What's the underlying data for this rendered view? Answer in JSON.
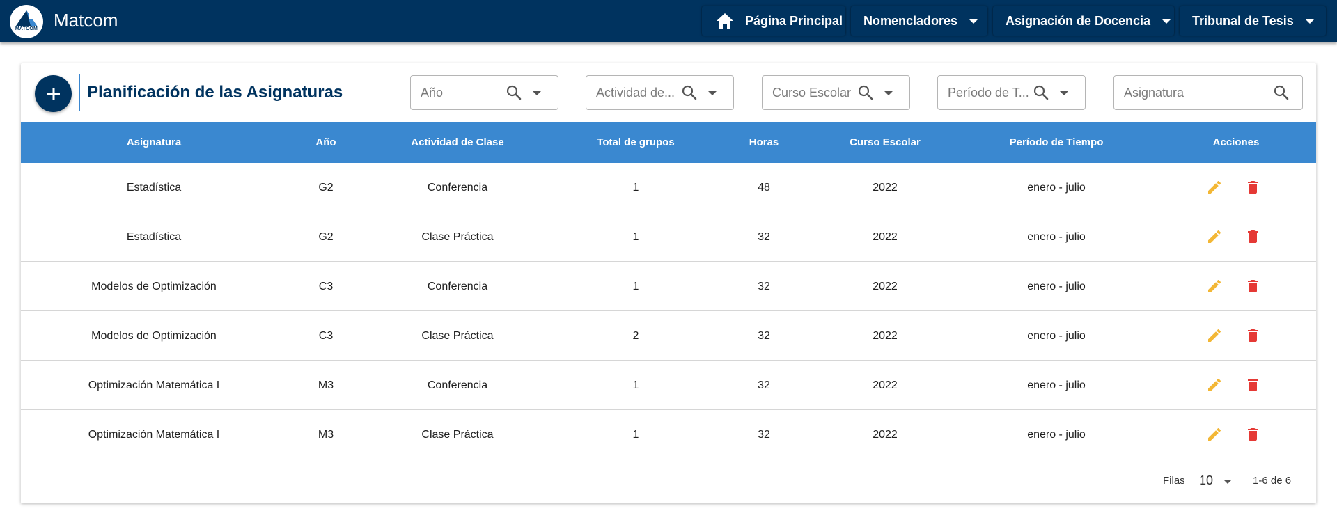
{
  "app": {
    "title": "Matcom",
    "logo_text": "MATCOM"
  },
  "nav": {
    "home": "Página Principal",
    "nomencladores": "Nomencladores",
    "asignacion": "Asignación de Docencia",
    "tribunal": "Tribunal de Tesis"
  },
  "page": {
    "title": "Planificación de las Asignaturas"
  },
  "filters": {
    "anio": "Año",
    "actividad": "Actividad de...",
    "curso": "Curso Escolar",
    "periodo": "Período de T...",
    "asignatura": "Asignatura"
  },
  "table": {
    "headers": [
      "Asignatura",
      "Año",
      "Actividad de Clase",
      "Total de grupos",
      "Horas",
      "Curso Escolar",
      "Período de Tiempo",
      "Acciones"
    ],
    "rows": [
      [
        "Estadística",
        "G2",
        "Conferencia",
        "1",
        "48",
        "2022",
        "enero - julio"
      ],
      [
        "Estadística",
        "G2",
        "Clase Práctica",
        "1",
        "32",
        "2022",
        "enero - julio"
      ],
      [
        "Modelos de Optimización",
        "C3",
        "Conferencia",
        "1",
        "32",
        "2022",
        "enero - julio"
      ],
      [
        "Modelos de Optimización",
        "C3",
        "Clase Práctica",
        "2",
        "32",
        "2022",
        "enero - julio"
      ],
      [
        "Optimización Matemática I",
        "M3",
        "Conferencia",
        "1",
        "32",
        "2022",
        "enero - julio"
      ],
      [
        "Optimización Matemática I",
        "M3",
        "Clase Práctica",
        "1",
        "32",
        "2022",
        "enero - julio"
      ]
    ]
  },
  "pagination": {
    "rows_label": "Filas",
    "rows_per_page": "10",
    "range": "1-6 de 6"
  },
  "colors": {
    "navy": "#00335f",
    "header_blue": "#3a88d0",
    "edit": "#f3b735",
    "delete": "#e53935"
  },
  "icons": {
    "home": "home-icon",
    "add": "plus-icon",
    "search": "search-icon",
    "edit": "pencil-icon",
    "delete": "trash-icon"
  }
}
